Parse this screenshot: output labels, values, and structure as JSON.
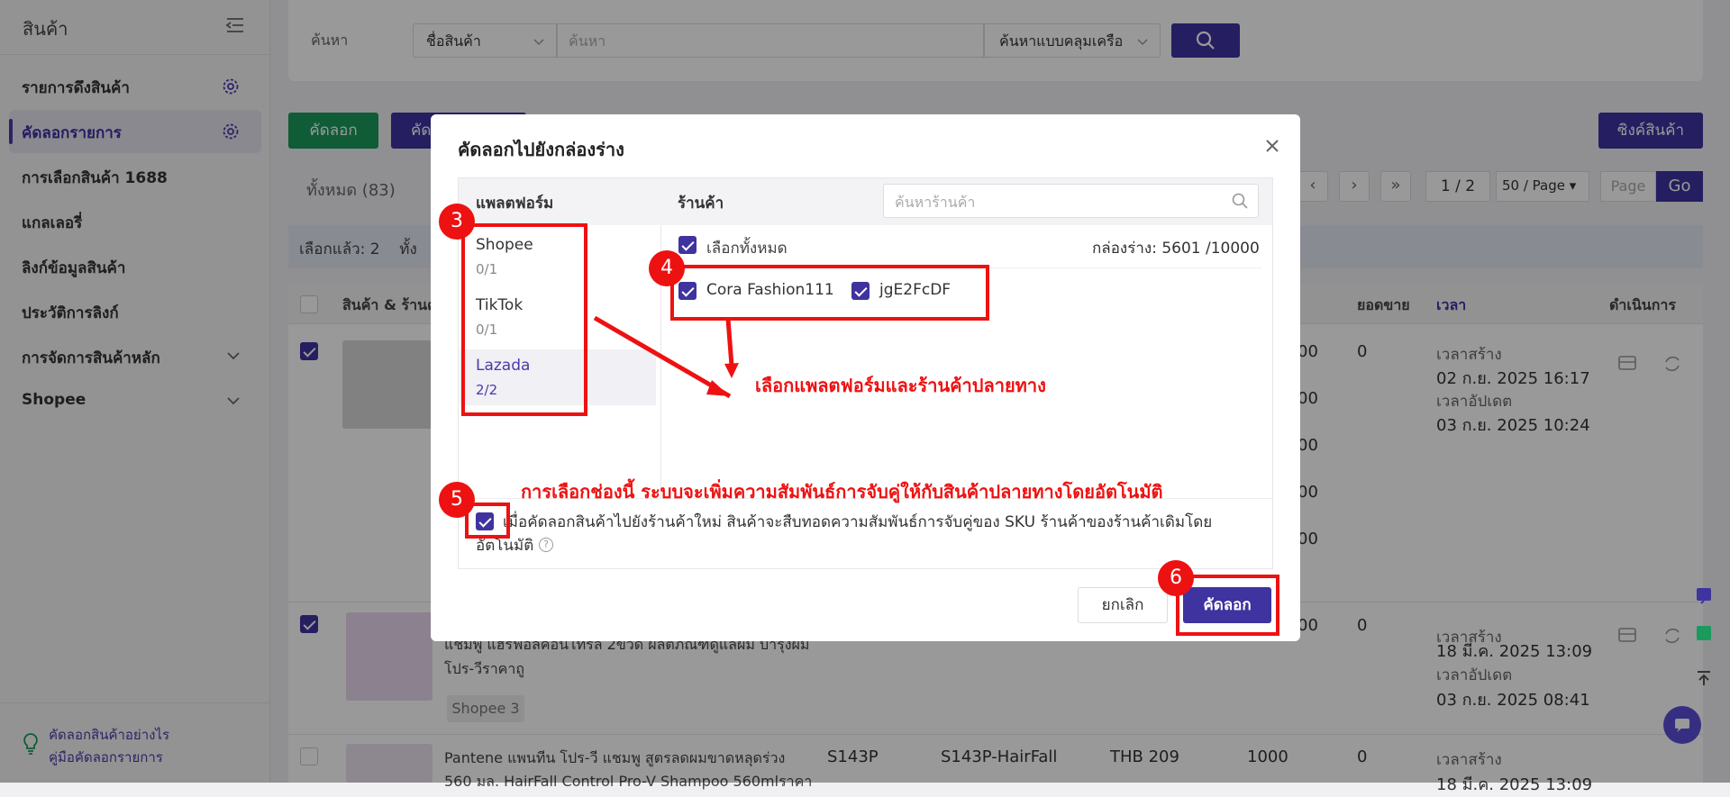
{
  "sidebar": {
    "title": "สินค้า",
    "items": [
      {
        "label": "รายการดึงสินค้า"
      },
      {
        "label": "คัดลอกรายการ"
      },
      {
        "label": "การเลือกสินค้า 1688"
      },
      {
        "label": "แกลเลอรี่"
      },
      {
        "label": "ลิงก์ข้อมูลสินค้า"
      },
      {
        "label": "ประวัติการลิงก์"
      },
      {
        "label": "การจัดการสินค้าหลัก"
      },
      {
        "label": "Shopee"
      }
    ],
    "help": {
      "line1": "คัดลอกสินค้าอย่างไร",
      "line2": "คู่มือคัดลอกรายการ"
    }
  },
  "search": {
    "label": "ค้นหา",
    "field": "ชื่อสินค้า",
    "placeholder": "ค้นหา",
    "mode": "ค้นหาแบบคลุมเครือ"
  },
  "toolbar": {
    "copy": "คัดลอก",
    "copy2": "คัด",
    "sync": "ซิงค์สินค้า"
  },
  "list": {
    "total": "ทั้งหมด (83)",
    "selected": "เลือกแล้ว: 2",
    "selected_tail": "ทั้ง",
    "page": "1 / 2",
    "page_size": "50 / Page",
    "page_input": "Page",
    "go": "Go"
  },
  "table": {
    "headers": {
      "product": "สินค้า & ร้านค้",
      "sales": "ยอดขาย",
      "time": "เวลา",
      "action": "ดำเนินการ"
    },
    "row1": {
      "qty": [
        "00",
        "00",
        "00",
        "00",
        "00"
      ],
      "sales": "0",
      "created_label": "เวลาสร้าง",
      "created": "02 ก.ย. 2025 16:17",
      "updated_label": "เวลาอัปเดต",
      "updated": "03 ก.ย. 2025 10:24"
    },
    "row2": {
      "title1": "แชมพู แฮรฟอลคอนโทรล 2ขวด ผลิตภัณฑ์ดูแลผม บำรุงผม",
      "title2": "โปร-วีราคาถู",
      "shop": "Shopee 3",
      "qty": "00",
      "sales": "0",
      "created_label": "เวลาสร้าง",
      "created": "18 มี.ค. 2025 13:09",
      "updated_label": "เวลาอัปเดต",
      "updated": "03 ก.ย. 2025 08:41"
    },
    "row3": {
      "title1": "Pantene แพนทีน โปร-วี แชมพู สูตรลดผมขาดหลุดร่วง",
      "title2": "560 มล. HairFall Control Pro-V Shampoo 560mlราคา",
      "sku": "S143P",
      "sku2": "S143P-HairFall",
      "price": "THB 209",
      "stock": "1000",
      "sales": "0",
      "created_label": "เวลาสร้าง",
      "created": "18 มี.ค. 2025 13:09"
    }
  },
  "modal": {
    "title": "คัดลอกไปยังกล่องร่าง",
    "platform_header": "แพลตฟอร์ม",
    "shop_header": "ร้านค้า",
    "shop_search_placeholder": "ค้นหาร้านค้า",
    "platforms": [
      {
        "name": "Shopee",
        "count": "0/1"
      },
      {
        "name": "TikTok",
        "count": "0/1"
      },
      {
        "name": "Lazada",
        "count": "2/2"
      }
    ],
    "select_all": "เลือกทั้งหมด",
    "drafts": "กล่องร่าง: 5601 /10000",
    "shops": [
      "Cora Fashion111",
      "jgE2FcDF"
    ],
    "sku_text": "เมื่อคัดลอกสินค้าไปยังร้านค้าใหม่ สินค้าจะสืบทอดความสัมพันธ์การจับคู่ของ SKU ร้านค้าของร้านค้าเดิมโดยอัตโนมัติ",
    "cancel": "ยกเลิก",
    "confirm": "คัดลอก"
  },
  "annotations": {
    "b3": "3",
    "b4": "4",
    "b5": "5",
    "b6": "6",
    "select_note": "เลือกแพลตฟอร์มและร้านค้าปลายทาง",
    "checkbox_note": "การเลือกช่องนี้ ระบบจะเพิ่มความสัมพันธ์การจับคู่ให้กับสินค้าปลายทางโดยอัตโนมัติ",
    "color": "#ee1111"
  },
  "colors": {
    "accent": "#3f33a0",
    "green": "#1a9a5c"
  }
}
